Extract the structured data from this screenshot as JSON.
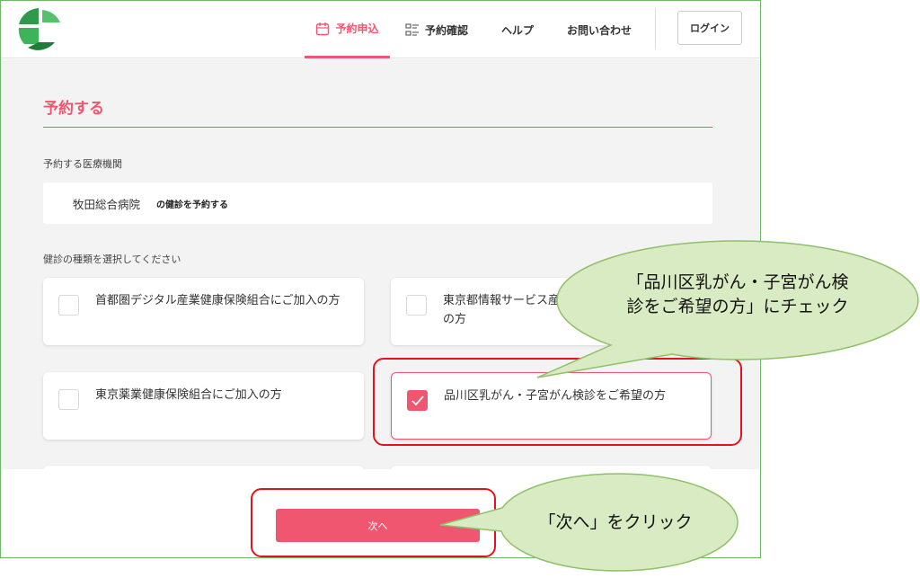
{
  "header": {
    "nav": [
      {
        "label": "予約申込",
        "icon": "calendar-icon",
        "active": true
      },
      {
        "label": "予約確認",
        "icon": "list-icon",
        "active": false
      },
      {
        "label": "ヘルプ",
        "active": false
      },
      {
        "label": "お問い合わせ",
        "active": false
      }
    ],
    "login_label": "ログイン"
  },
  "main": {
    "title": "予約する",
    "institution_label": "予約する医療機関",
    "institution_name": "牧田総合病院",
    "institution_suffix": "の健診を予約する",
    "type_label": "健診の種類を選択してください",
    "options": [
      {
        "label": "首都圏デジタル産業健康保険組合にご加入の方",
        "checked": false
      },
      {
        "label": "東京都情報サービス産業健康保険組合にご加入の方",
        "checked": false
      },
      {
        "label": "東京薬業健康保険組合にご加入の方",
        "checked": false
      },
      {
        "label": "品川区乳がん・子宮がん検診をご希望の方",
        "checked": true
      }
    ]
  },
  "footer": {
    "next_label": "次へ"
  },
  "annotations": {
    "callout_check": "「品川区乳がん・子宮がん検診をご希望の方」にチェック",
    "callout_check_line1": "「品川区乳がん・子宮がん検",
    "callout_check_line2": "診をご希望の方」にチェック",
    "callout_next": "「次へ」をクリック"
  },
  "colors": {
    "accent": "#f0566f",
    "highlight": "#e0141e",
    "bubble_fill": "#d9ebc2",
    "bubble_stroke": "#8fc06a"
  }
}
